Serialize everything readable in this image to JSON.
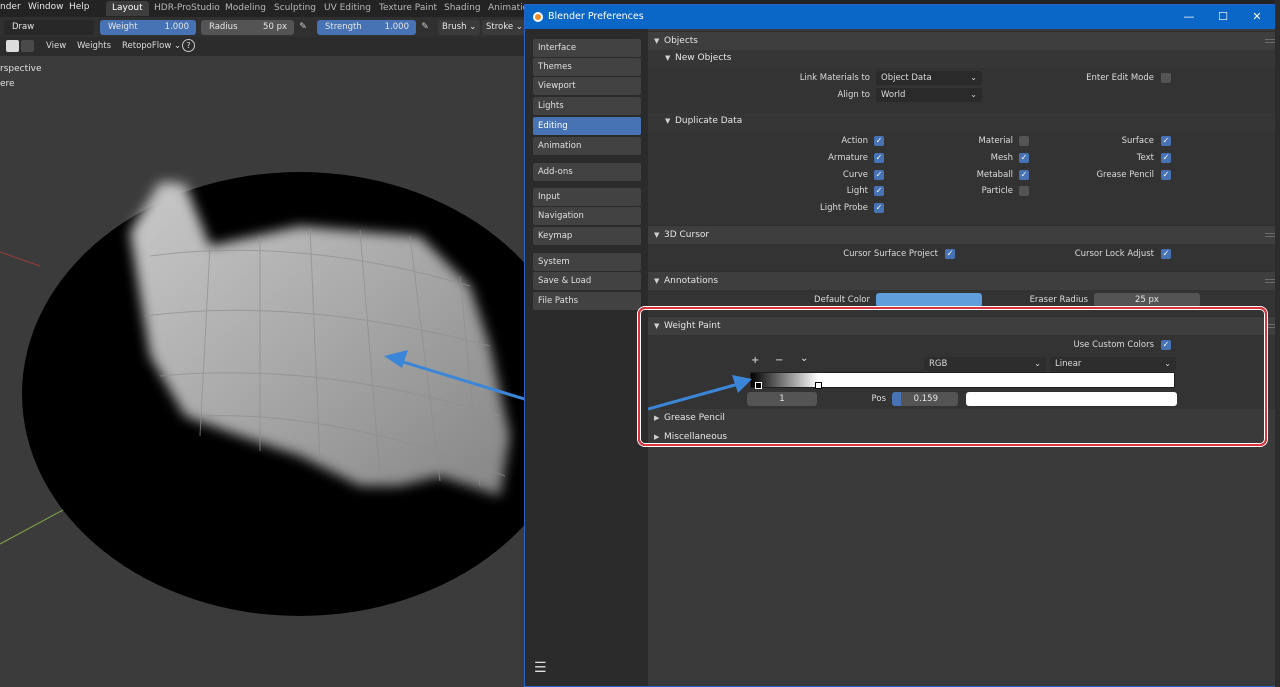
{
  "main_window": {
    "menu": [
      "nder",
      "Window",
      "Help"
    ],
    "workspace_tabs": [
      {
        "label": "Layout",
        "active": true
      },
      {
        "label": "HDR-ProStudio",
        "active": false
      },
      {
        "label": "Modeling",
        "active": false
      },
      {
        "label": "Sculpting",
        "active": false
      },
      {
        "label": "UV Editing",
        "active": false
      },
      {
        "label": "Texture Paint",
        "active": false
      },
      {
        "label": "Shading",
        "active": false
      },
      {
        "label": "Animatio",
        "active": false
      }
    ],
    "tool_settings": {
      "brush_name": "Draw",
      "weight_label": "Weight",
      "weight_value": "1.000",
      "radius_label": "Radius",
      "radius_value": "50 px",
      "strength_label": "Strength",
      "strength_value": "1.000",
      "brush_menu": "Brush",
      "stroke_menu": "Stroke"
    },
    "header2": {
      "view_label": "View",
      "weights_label": "Weights",
      "retopoflow_label": "RetopoFlow",
      "help_glyph": "?"
    },
    "viewport_overlay": [
      "rspective",
      "ere"
    ]
  },
  "preferences": {
    "title": "Blender Preferences",
    "win_controls": {
      "minimize": "—",
      "maximize": "☐",
      "close": "✕"
    },
    "nav_items": [
      {
        "label": "Interface",
        "active": false
      },
      {
        "label": "Themes",
        "active": false
      },
      {
        "label": "Viewport",
        "active": false
      },
      {
        "label": "Lights",
        "active": false
      },
      {
        "label": "Editing",
        "active": true
      },
      {
        "label": "Animation",
        "active": false
      },
      {
        "label": "Add-ons",
        "active": false
      },
      {
        "label": "Input",
        "active": false
      },
      {
        "label": "Navigation",
        "active": false
      },
      {
        "label": "Keymap",
        "active": false
      },
      {
        "label": "System",
        "active": false
      },
      {
        "label": "Save & Load",
        "active": false
      },
      {
        "label": "File Paths",
        "active": false
      }
    ],
    "objects": {
      "title": "Objects",
      "new_objects": {
        "title": "New Objects",
        "link_materials_label": "Link Materials to",
        "link_materials_value": "Object Data",
        "align_to_label": "Align to",
        "align_to_value": "World",
        "enter_edit_mode_label": "Enter Edit Mode",
        "enter_edit_mode_checked": false
      },
      "duplicate_data": {
        "title": "Duplicate Data",
        "items": [
          {
            "label": "Action",
            "checked": true
          },
          {
            "label": "Armature",
            "checked": true
          },
          {
            "label": "Curve",
            "checked": true
          },
          {
            "label": "Light",
            "checked": true
          },
          {
            "label": "Light Probe",
            "checked": true
          },
          {
            "label": "Material",
            "checked": false
          },
          {
            "label": "Mesh",
            "checked": true
          },
          {
            "label": "Metaball",
            "checked": true
          },
          {
            "label": "Particle",
            "checked": false
          },
          {
            "label": "Surface",
            "checked": true
          },
          {
            "label": "Text",
            "checked": true
          },
          {
            "label": "Grease Pencil",
            "checked": true
          }
        ]
      }
    },
    "cursor_3d": {
      "title": "3D Cursor",
      "surface_project_label": "Cursor Surface Project",
      "surface_project_checked": true,
      "lock_adjust_label": "Cursor Lock Adjust",
      "lock_adjust_checked": true
    },
    "annotations": {
      "title": "Annotations",
      "default_color_label": "Default Color",
      "default_color": "#5f9ddb",
      "eraser_radius_label": "Eraser Radius",
      "eraser_radius_value": "25 px"
    },
    "weight_paint": {
      "title": "Weight Paint",
      "use_custom_colors_label": "Use Custom Colors",
      "use_custom_colors_checked": true,
      "add_glyph": "+",
      "remove_glyph": "−",
      "menu_glyph": "⌄",
      "color_mode": "RGB",
      "interpolation": "Linear",
      "active_index": "1",
      "pos_label": "Pos",
      "pos_value": "0.159",
      "stop_position": 0.159,
      "stop_color": "#ffffff"
    },
    "collapsed_panels": [
      "Grease Pencil",
      "Miscellaneous"
    ]
  },
  "colors": {
    "accent": "#4772b3",
    "highlight_border": "#d9333e",
    "title_bar": "#0a66c7"
  }
}
